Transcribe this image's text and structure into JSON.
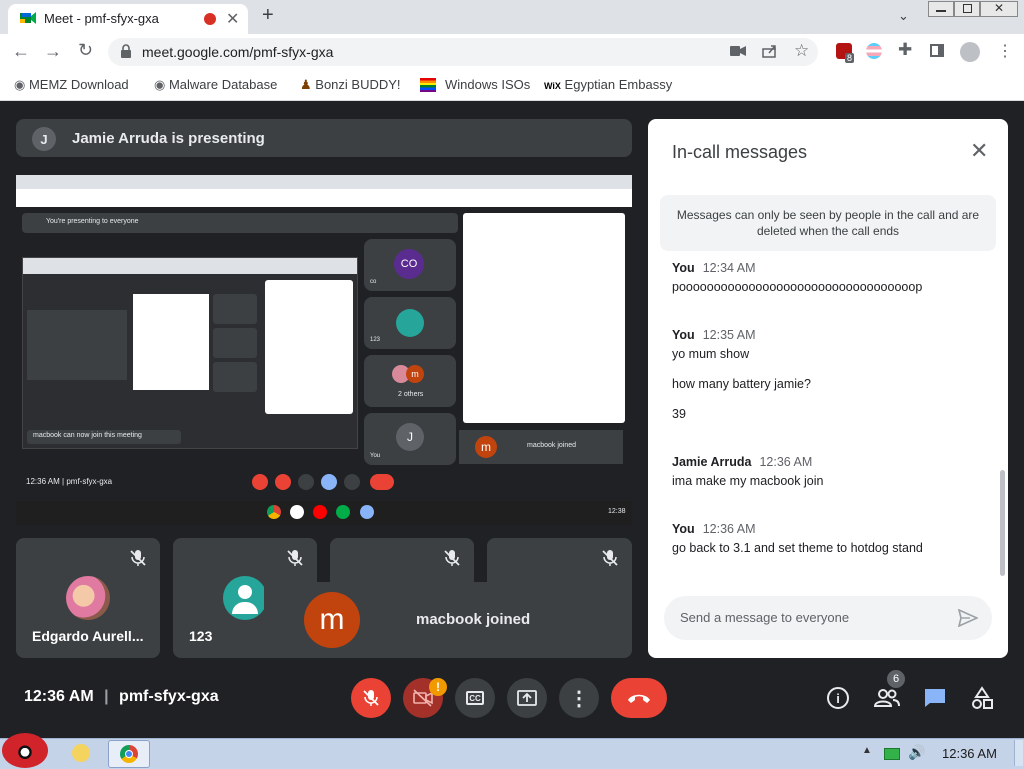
{
  "browser": {
    "tab_title": "Meet - pmf-sfyx-gxa",
    "url": "meet.google.com/pmf-sfyx-gxa",
    "extension_badge": "8",
    "bookmarks": [
      "MEMZ Download",
      "Malware Database",
      "Bonzi BUDDY!",
      "Windows ISOs",
      "Egyptian Embassy"
    ]
  },
  "presenting": {
    "avatar_letter": "J",
    "text": "Jamie Arruda is presenting"
  },
  "shared_screen": {
    "presenting_notice": "You're presenting to everyone",
    "time_code": "12:36 AM  |  pmf-sfyx-gxa",
    "toast": "macbook can now join this meeting",
    "inner_tile_co": "CO",
    "inner_tile_co_label": "co",
    "inner_tile_123": "123",
    "inner_tile_others": "2 others",
    "inner_tile_you": "You",
    "inner_tile_you_letter": "J",
    "inner_toast": "macbook joined",
    "inner_toast_letter": "m",
    "taskbar_clock": "12:38"
  },
  "tiles": [
    {
      "name": "Edgardo Aurell..."
    },
    {
      "name": "123"
    }
  ],
  "toast": {
    "avatar_letter": "m",
    "text": "macbook joined"
  },
  "panel": {
    "title": "In-call messages",
    "notice": "Messages can only be seen by people in the call and are deleted when the call ends",
    "messages": [
      {
        "sender": "You",
        "time": "12:34 AM",
        "lines": [
          "poooooooooooooooooooooooooooooooooop"
        ]
      },
      {
        "sender": "You",
        "time": "12:35 AM",
        "lines": [
          "yo mum show",
          "how many battery jamie?",
          "39"
        ]
      },
      {
        "sender": "Jamie Arruda",
        "time": "12:36 AM",
        "lines": [
          "ima make my macbook join"
        ]
      },
      {
        "sender": "You",
        "time": "12:36 AM",
        "lines": [
          "go back to 3.1 and set theme to hotdog stand"
        ]
      }
    ],
    "input_placeholder": "Send a message to everyone"
  },
  "bottom": {
    "time": "12:36 AM",
    "meeting_code": "pmf-sfyx-gxa",
    "people_count": "6",
    "camera_warning": "!"
  },
  "taskbar": {
    "clock": "12:36 AM"
  },
  "colors": {
    "red": "#ea4335",
    "dark": "#202124",
    "tile": "#3c4043",
    "accent_blue": "#1a73e8"
  }
}
